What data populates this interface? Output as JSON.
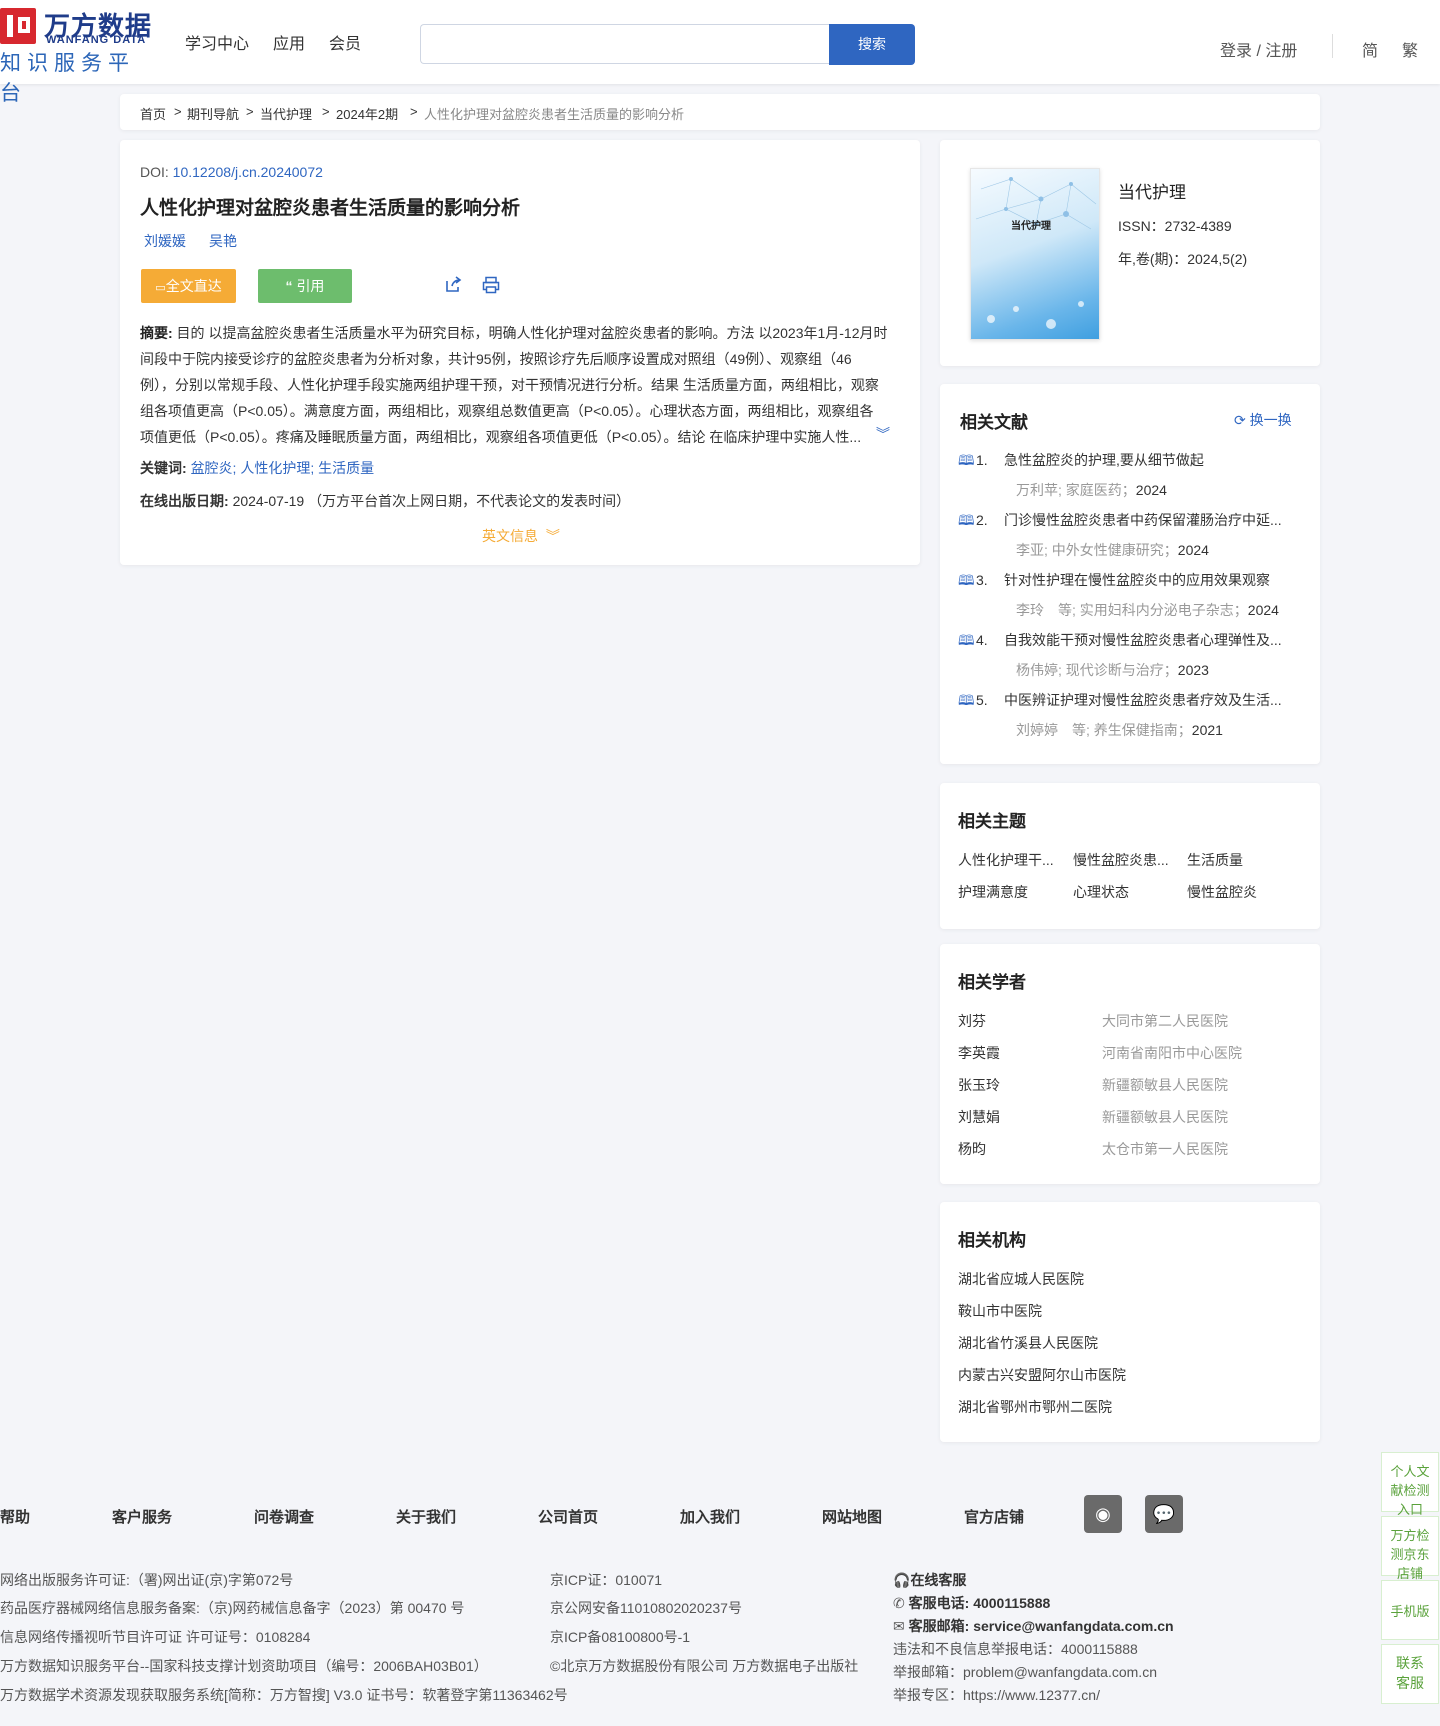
{
  "header": {
    "logo_cn": "万方数据",
    "logo_en": "WANFANG DATA",
    "logo_sub": "知识服务平台",
    "nav": [
      "学习中心",
      "应用",
      "会员"
    ],
    "search_placeholder": "",
    "search_button": "搜索",
    "login": "登录 / 注册",
    "lang_simplified": "简",
    "lang_traditional": "繁"
  },
  "breadcrumb": [
    "首页",
    "期刊导航",
    "当代护理",
    "2024年2期",
    "人性化护理对盆腔炎患者生活质量的影响分析"
  ],
  "article": {
    "doi_label": "DOI: ",
    "doi": "10.12208/j.cn.20240072",
    "title": "人性化护理对盆腔炎患者生活质量的影响分析",
    "authors": [
      "刘媛媛",
      "吴艳"
    ],
    "btn_fulltext": "全文直达",
    "btn_cite": "引用",
    "abstract_label": "摘要:",
    "abstract_lines": [
      " 目的 以提高盆腔炎患者生活质量水平为研究目标，明确人性化护理对盆腔炎患者的影响。方法 以2023年1月-12月时",
      "间段中于院内接受诊疗的盆腔炎患者为分析对象，共计95例，按照诊疗先后顺序设置成对照组（49例）、观察组（46",
      "例），分别以常规手段、人性化护理手段实施两组护理干预，对干预情况进行分析。结果 生活质量方面，两组相比，观察",
      "组各项值更高（P<0.05）。满意度方面，两组相比，观察组总数值更高（P<0.05）。心理状态方面，两组相比，观察组各",
      "项值更低（P<0.05）。疼痛及睡眠质量方面，两组相比，观察组各项值更低（P<0.05）。结论 在临床护理中实施人性..."
    ],
    "keywords_label": "关键词:",
    "keywords": [
      "盆腔炎;",
      "人性化护理;",
      "生活质量"
    ],
    "date_label": "在线出版日期:",
    "date": "2024-07-19",
    "date_note": "（万方平台首次上网日期，不代表论文的发表时间）",
    "english_info": "英文信息"
  },
  "journal": {
    "cover_title": "当代护理",
    "title": "当代护理",
    "issn": "ISSN：2732-4389",
    "volume": "年,卷(期)：2024,5(2)"
  },
  "related_docs": {
    "title": "相关文献",
    "refresh": "换一换",
    "items": [
      {
        "num": "1.",
        "title": "急性盆腔炎的护理,要从细节做起",
        "meta": "万利苹; 家庭医药；",
        "year": "2024"
      },
      {
        "num": "2.",
        "title": "门诊慢性盆腔炎患者中药保留灌肠治疗中延...",
        "meta": "李亚; 中外女性健康研究；",
        "year": "2024"
      },
      {
        "num": "3.",
        "title": "针对性护理在慢性盆腔炎中的应用效果观察",
        "meta": "李玲　等; 实用妇科内分泌电子杂志；",
        "year": "2024"
      },
      {
        "num": "4.",
        "title": "自我效能干预对慢性盆腔炎患者心理弹性及...",
        "meta": "杨伟婷; 现代诊断与治疗；",
        "year": "2023"
      },
      {
        "num": "5.",
        "title": "中医辨证护理对慢性盆腔炎患者疗效及生活...",
        "meta": "刘婷婷　等; 养生保健指南；",
        "year": "2021"
      }
    ]
  },
  "related_topics": {
    "title": "相关主题",
    "items": [
      "人性化护理干...",
      "慢性盆腔炎患...",
      "生活质量",
      "护理满意度",
      "心理状态",
      "慢性盆腔炎"
    ]
  },
  "related_scholars": {
    "title": "相关学者",
    "items": [
      {
        "name": "刘芬",
        "org": "大同市第二人民医院"
      },
      {
        "name": "李英霞",
        "org": "河南省南阳市中心医院"
      },
      {
        "name": "张玉玲",
        "org": "新疆额敏县人民医院"
      },
      {
        "name": "刘慧娟",
        "org": "新疆额敏县人民医院"
      },
      {
        "name": "杨昀",
        "org": "太仓市第一人民医院"
      }
    ]
  },
  "related_orgs": {
    "title": "相关机构",
    "items": [
      "湖北省应城人民医院",
      "鞍山市中医院",
      "湖北省竹溪县人民医院",
      "内蒙古兴安盟阿尔山市医院",
      "湖北省鄂州市鄂州二医院"
    ]
  },
  "footer": {
    "links": [
      "帮助",
      "客户服务",
      "问卷调查",
      "关于我们",
      "公司首页",
      "加入我们",
      "网站地图",
      "官方店铺"
    ],
    "col1": [
      "网络出版服务许可证:（署)网出证(京)字第072号",
      "药品医疗器械网络信息服务备案:（京)网药械信息备字（2023）第 00470 号",
      "信息网络传播视听节目许可证 许可证号：0108284",
      "万方数据知识服务平台--国家科技支撑计划资助项目（编号：2006BAH03B01）",
      "万方数据学术资源发现获取服务系统[简称：万方智搜] V3.0 证书号：软著登字第11363462号"
    ],
    "col2": [
      "京ICP证：010071",
      "京公网安备11010802020237号",
      "京ICP备08100800号-1",
      "©北京万方数据股份有限公司 万方数据电子出版社"
    ],
    "online_service": "在线客服",
    "phone_label": "客服电话:",
    "phone": "4000115888",
    "email_label": "客服邮箱:",
    "email": "service@wanfangdata.com.cn",
    "report_phone": "违法和不良信息举报电话：4000115888",
    "report_email": "举报邮箱：problem@wanfangdata.com.cn",
    "report_site": "举报专区：https://www.12377.cn/"
  },
  "float_tabs": [
    "个人文献检测入口",
    "万方检测京东店铺",
    "手机版",
    "联系客服"
  ]
}
